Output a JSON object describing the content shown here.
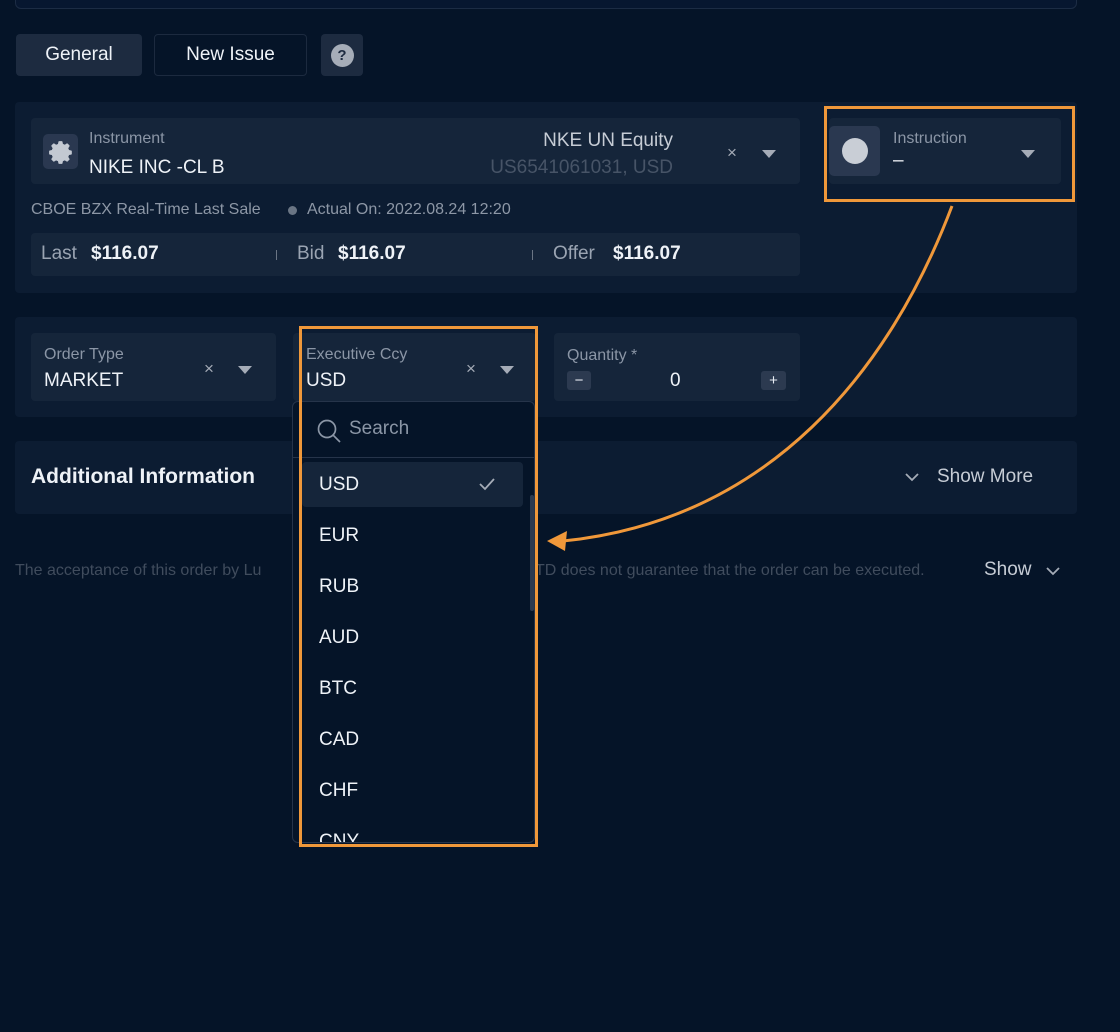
{
  "tabs": {
    "general": "General",
    "new_issue": "New Issue",
    "help": "?"
  },
  "instrument": {
    "label": "Instrument",
    "name": "NIKE INC -CL B",
    "ticker": "NKE UN Equity",
    "isin": "US6541061031, USD",
    "clear": "×"
  },
  "instruction": {
    "label": "Instruction",
    "value": "–"
  },
  "source": {
    "feed": "CBOE BZX Real-Time Last Sale",
    "actual_on": "Actual On: 2022.08.24 12:20"
  },
  "prices": {
    "last_label": "Last",
    "last_value": "$116.07",
    "bid_label": "Bid",
    "bid_value": "$116.07",
    "offer_label": "Offer",
    "offer_value": "$116.07"
  },
  "order_type": {
    "label": "Order Type",
    "value": "MARKET",
    "clear": "×"
  },
  "exec_ccy": {
    "label": "Executive Ccy",
    "value": "USD",
    "clear": "×"
  },
  "quantity": {
    "label": "Quantity *",
    "value": "0",
    "minus": "−",
    "plus": "+"
  },
  "currency_dropdown": {
    "search_placeholder": "Search",
    "options": [
      "USD",
      "EUR",
      "RUB",
      "AUD",
      "BTC",
      "CAD",
      "CHF",
      "CNY"
    ],
    "selected": "USD"
  },
  "additional": {
    "title": "Additional Information",
    "show_more": "Show More"
  },
  "disclaimer": {
    "text_left": "The acceptance of this order by Lu",
    "text_right": "TD does not guarantee that the order can be executed.",
    "show": "Show"
  },
  "colors": {
    "highlight": "#f0983a",
    "background": "#051428",
    "panel": "#0c1c32",
    "field": "#15253a"
  }
}
